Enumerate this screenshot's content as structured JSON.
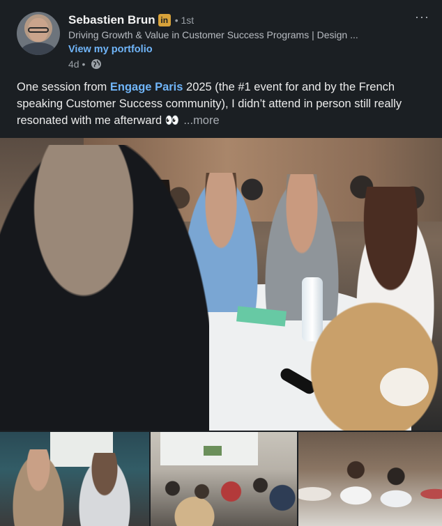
{
  "author": {
    "name": "Sebastien Brun",
    "badge": "in",
    "degree": "• 1st",
    "headline": "Driving Growth & Value in Customer Success Programs | Design ...",
    "portfolio_link": "View my portfolio",
    "time": "4d •",
    "visibility_icon": "globe-icon"
  },
  "menu": {
    "label": "···"
  },
  "post": {
    "text_before": "One session from ",
    "link": "Engage Paris",
    "text_after": " 2025 (the #1 event for and by the French speaking Customer Success community), I didn’t attend in person still really resonated with me afterward 👀",
    "see_more": "...more"
  },
  "colors": {
    "background": "#1b1f23",
    "link": "#70b5f9",
    "badge": "#d8a23a"
  }
}
